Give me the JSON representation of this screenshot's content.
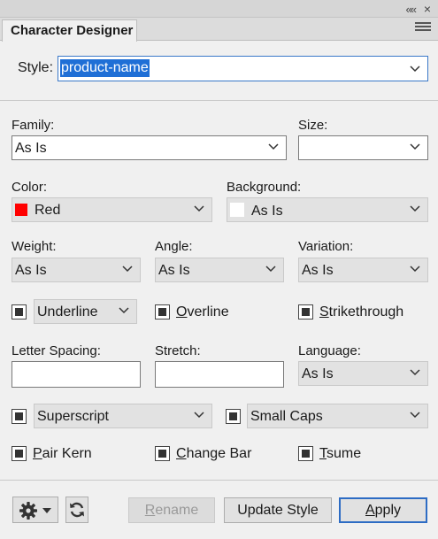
{
  "panel": {
    "tab_title": "Character Designer",
    "collapse_glyph": "«",
    "close_glyph": "×"
  },
  "style": {
    "label": "Style:",
    "value": "product-name"
  },
  "fields": {
    "family": {
      "label": "Family:",
      "value": "As Is"
    },
    "size": {
      "label": "Size:",
      "value": ""
    },
    "color": {
      "label": "Color:",
      "value": "Red",
      "swatch": "#ff0000"
    },
    "background": {
      "label": "Background:",
      "value": "As Is",
      "swatch": "#ffffff"
    },
    "weight": {
      "label": "Weight:",
      "value": "As Is"
    },
    "angle": {
      "label": "Angle:",
      "value": "As Is"
    },
    "variation": {
      "label": "Variation:",
      "value": "As Is"
    },
    "underline": {
      "value": "Underline"
    },
    "overline": {
      "label": "Overline",
      "accel": "O",
      "rest": "verline"
    },
    "strikethrough": {
      "label": "Strikethrough",
      "accel": "S",
      "rest": "trikethrough"
    },
    "letter_spacing": {
      "label": "Letter Spacing:",
      "value": ""
    },
    "stretch": {
      "label": "Stretch:",
      "value": ""
    },
    "language": {
      "label": "Language:",
      "value": "As Is"
    },
    "superscript": {
      "value": "Superscript"
    },
    "small_caps": {
      "value": "Small Caps"
    },
    "pair_kern": {
      "label": "Pair Kern",
      "accel": "P",
      "rest": "air Kern"
    },
    "change_bar": {
      "label": "Change Bar",
      "accel": "C",
      "rest": "hange Bar"
    },
    "tsume": {
      "label": "Tsume",
      "accel": "T",
      "rest": "sume"
    }
  },
  "buttons": {
    "rename": {
      "label": "Rename",
      "accel": "R",
      "rest": "ename"
    },
    "update_style": {
      "label": "Update Style"
    },
    "apply": {
      "label": "Apply",
      "accel": "A",
      "rest": "pply"
    }
  },
  "icons": {
    "settings": "gear-icon",
    "refresh": "refresh-icon"
  }
}
